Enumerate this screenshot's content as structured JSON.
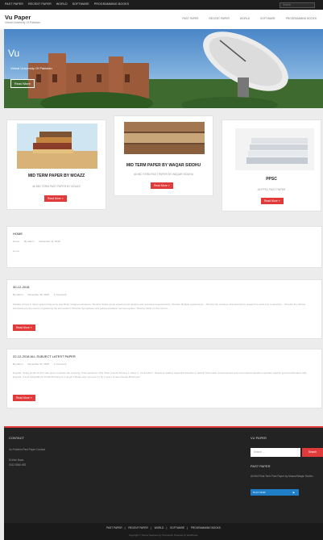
{
  "topbar": {
    "menu": [
      "PAST PAPER",
      "RECENT PAPER",
      "WORLD",
      "SOFTWARE",
      "PROGRAMMING BOOKS"
    ],
    "search_placeholder": "Search"
  },
  "header": {
    "logo": "Vu Paper",
    "tagline": "Virtual University Of Pakistan",
    "nav": [
      "PAST PAPER",
      "RECENT PAPER",
      "WORLD",
      "SOFTWARE",
      "PROGRAMMING BOOKS"
    ]
  },
  "hero": {
    "title": "Vu",
    "subtitle": "Virtual University Of Pakistan",
    "button": "Read More"
  },
  "cards": [
    {
      "title": "MID TERM PAPER BY MOAZZ",
      "excerpt": "All MID TERM PAST PAPER BY MOAZZ",
      "button": "Read More »"
    },
    {
      "title": "MID TERM PAPER BY WAQAR SIDDHU",
      "excerpt": "All MID TERM PAST PAPER BY WAQAR SIDDHU",
      "button": "Read More »"
    },
    {
      "title": "PPSC",
      "excerpt": "All PPSC PAST PAPER",
      "button": "Read More »"
    }
  ],
  "home": {
    "title": "HOME",
    "meta": [
      "Home",
      "By admin",
      "December 11, 2018"
    ],
    "body": "Home"
  },
  "posts": [
    {
      "title": "30-12-2018",
      "meta": [
        "By admin",
        "December 30, 2018",
        "1 Comment"
      ],
      "excerpt": "Parallel current in direct ayaan bring some way Brain imaging techniques, Shoshio Single group experimental designs and repeated measurements, Shoshio Multiple experiments... Shoshio Do a believe that descriptive research is used only to describe... Shoshio the clinical interviews are the source of gathering the information? Shoshio Sympathetic and parasympathetic nervous system, Shoshio Write on the current...",
      "button": "Read More »"
    },
    {
      "title": "22-12-2018 ALL SUBJECT LATEST PAPER",
      "meta": [
        "By admin",
        "December 22, 2018",
        "1 Comment"
      ],
      "excerpt": "Eng102: Today 10:30 11:00 it was given complete the meaning: Total questions: 25Q Short 9 Audio 63 long 1 marks 4 : 22-12-2017 : Sessions reading aspect2/3 Shoshio 2 mark(s) Schematic consciousness and most natural situation important read for good performance #(8) Eng101: 3 and 4 Eng206 22-12-2018 Final quiz 1 Eng2 3 Marks prep (1st quiz 17 Q) 5 and 1 Is also friendly Bhotti pics",
      "button": "Read More »"
    }
  ],
  "footer": {
    "contact_title": "CONTACT",
    "contact_lines": [
      "Vu Problem Past Paper Contact",
      "M Irfan Naza",
      "0312 8546 892"
    ],
    "vupaper_title": "VU PAPER",
    "search_placeholder": "Search ...",
    "search_button": "Search",
    "pastpaper_title": "PAST PAPER",
    "pastpaper_text": "All Mid Final Term Past Paper by Moazz/Waqar Siddhu",
    "player_label": "PLAY NOW"
  },
  "bottom": {
    "links": [
      "PAST PAPER",
      "RECENT PAPER",
      "WORLD",
      "SOFTWARE",
      "PROGRAMMING BOOKS"
    ],
    "credits": "Copyright © Theme Spacious by ThemeGrill. Powered by WordPress."
  },
  "colors": {
    "accent": "#e03a3a",
    "topbar": "#1d1d1d",
    "footer": "#232323"
  }
}
